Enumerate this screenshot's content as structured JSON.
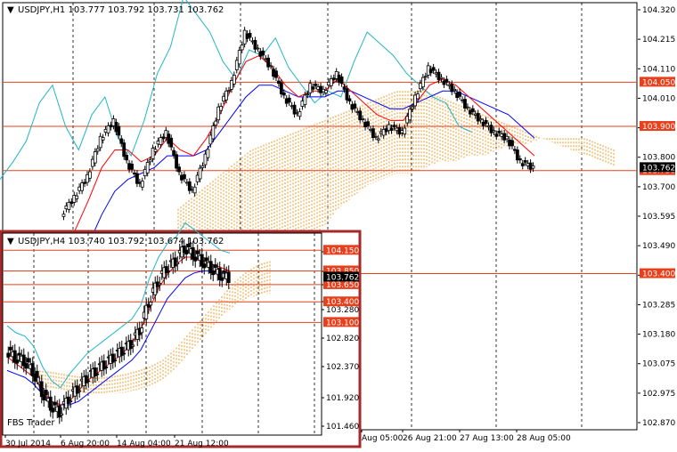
{
  "main_chart": {
    "title": "USDJPY,H1  103.777 103.792 103.731 103.762",
    "y_ticks": [
      "104.320",
      "104.215",
      "104.110",
      "104.010",
      "103.905",
      "103.800",
      "103.700",
      "103.595",
      "103.490",
      "103.385",
      "103.285",
      "103.180",
      "103.075",
      "102.975",
      "102.870"
    ],
    "x_ticks": [
      "Aug 05:00",
      "26 Aug 21:00",
      "27 Aug 13:00",
      "28 Aug 05:00"
    ],
    "levels": [
      {
        "label": "104.050",
        "value": 104.05
      },
      {
        "label": "103.900",
        "value": 103.9
      },
      {
        "label": "103.750",
        "value": 103.75
      },
      {
        "label": "103.400",
        "value": 103.4
      }
    ],
    "current_price_label": "103.762"
  },
  "inset_chart": {
    "title": "USDJPY,H4  103.740 103.792 103.674 103.762",
    "y_ticks": [
      "104.150",
      "103.850",
      "103.650",
      "103.400",
      "103.280",
      "102.820",
      "102.370",
      "101.920",
      "101.460"
    ],
    "x_ticks": [
      "30 Jul 2014",
      "6 Aug 20:00",
      "14 Aug 04:00",
      "21 Aug 12:00"
    ],
    "levels": [
      {
        "label": "104.150",
        "value": 104.15
      },
      {
        "label": "103.850",
        "value": 103.85
      },
      {
        "label": "103.650",
        "value": 103.65
      },
      {
        "label": "103.400",
        "value": 103.4
      },
      {
        "label": "103.100",
        "value": 103.1
      }
    ],
    "current_price_label": "103.762",
    "watermark": "FBS Trader"
  },
  "colors": {
    "level_line": "#e8401c",
    "level_tag": "#e8401c",
    "tenkan": "#ff0000",
    "kijun": "#0000ff",
    "chikou": "#21b5c6",
    "cloud": "#e89b28",
    "candle": "#000000",
    "inset_border": "#a52a2a"
  },
  "chart_data": [
    {
      "type": "candlestick",
      "title": "USDJPY,H1  103.777 103.792 103.731 103.762",
      "ylim": [
        102.87,
        104.32
      ],
      "indicator": "Ichimoku",
      "close_series": [
        103.6,
        103.66,
        103.73,
        103.86,
        103.92,
        103.78,
        103.7,
        103.82,
        103.88,
        103.74,
        103.68,
        103.8,
        103.96,
        104.05,
        104.22,
        104.16,
        104.1,
        104.0,
        103.94,
        104.04,
        104.02,
        104.08,
        103.98,
        103.92,
        103.86,
        103.9,
        103.88,
        104.0,
        104.1,
        104.06,
        104.02,
        103.96,
        103.92,
        103.88,
        103.86,
        103.78,
        103.76
      ],
      "tenkan_series": [
        103.45,
        103.55,
        103.65,
        103.76,
        103.82,
        103.82,
        103.78,
        103.8,
        103.86,
        103.82,
        103.8,
        103.86,
        103.94,
        104.04,
        104.12,
        104.14,
        104.1,
        104.04,
        104.0,
        104.02,
        104.02,
        104.06,
        104.02,
        103.98,
        103.94,
        103.92,
        103.92,
        103.98,
        104.04,
        104.06,
        104.04,
        104.0,
        103.96,
        103.92,
        103.88,
        103.84,
        103.8
      ],
      "kijun_series": [
        103.32,
        103.4,
        103.5,
        103.6,
        103.68,
        103.72,
        103.74,
        103.76,
        103.8,
        103.8,
        103.8,
        103.82,
        103.88,
        103.94,
        104.0,
        104.04,
        104.04,
        104.02,
        104.0,
        104.0,
        104.0,
        104.02,
        104.02,
        104.0,
        103.98,
        103.96,
        103.96,
        103.98,
        104.0,
        104.02,
        104.02,
        104.0,
        103.98,
        103.96,
        103.94,
        103.9,
        103.86
      ],
      "cloud_top": [
        103.62,
        103.66,
        103.7,
        103.74,
        103.78,
        103.82,
        103.84,
        103.86,
        103.88,
        103.9,
        103.92,
        103.94,
        103.96,
        103.98,
        104.0,
        104.02,
        104.02,
        104.02,
        104.0,
        103.98,
        103.96,
        103.94,
        103.92,
        103.9,
        103.88,
        103.86,
        103.84,
        103.82,
        103.8,
        103.78,
        103.76
      ],
      "cloud_bottom": [
        103.48,
        103.44,
        103.4,
        103.36,
        103.34,
        103.34,
        103.36,
        103.4,
        103.44,
        103.5,
        103.56,
        103.62,
        103.66,
        103.7,
        103.72,
        103.74,
        103.74,
        103.76,
        103.78,
        103.78,
        103.8,
        103.8,
        103.82,
        103.84,
        103.84,
        103.86,
        103.86,
        103.86,
        103.86,
        103.84,
        103.82
      ]
    },
    {
      "type": "candlestick",
      "title": "USDJPY,H4  103.740 103.792 103.674 103.762",
      "ylim": [
        101.46,
        104.4
      ],
      "indicator": "Ichimoku",
      "close_series": [
        102.7,
        102.6,
        102.55,
        102.4,
        102.1,
        101.9,
        101.8,
        102.0,
        102.15,
        102.3,
        102.4,
        102.5,
        102.6,
        102.7,
        102.8,
        103.0,
        103.4,
        103.7,
        103.9,
        104.0,
        104.2,
        104.1,
        104.0,
        103.9,
        103.8,
        103.76
      ],
      "tenkan_series": [
        102.6,
        102.5,
        102.4,
        102.3,
        102.1,
        101.95,
        101.9,
        101.95,
        102.1,
        102.25,
        102.35,
        102.45,
        102.55,
        102.65,
        102.8,
        103.0,
        103.3,
        103.6,
        103.8,
        103.95,
        104.05,
        104.05,
        104.0,
        103.95,
        103.9,
        103.85
      ],
      "kijun_series": [
        102.4,
        102.35,
        102.3,
        102.2,
        102.05,
        101.95,
        101.9,
        101.9,
        101.95,
        102.05,
        102.15,
        102.25,
        102.35,
        102.45,
        102.55,
        102.7,
        102.95,
        103.2,
        103.45,
        103.6,
        103.75,
        103.82,
        103.85,
        103.85,
        103.82,
        103.8
      ],
      "cloud_top": [
        102.4,
        102.38,
        102.35,
        102.32,
        102.3,
        102.3,
        102.32,
        102.35,
        102.4,
        102.46,
        102.55,
        102.7,
        102.9,
        103.1,
        103.3,
        103.5,
        103.7,
        103.85,
        103.95,
        104.0
      ],
      "cloud_bottom": [
        102.15,
        102.12,
        102.1,
        102.08,
        102.05,
        102.05,
        102.06,
        102.08,
        102.12,
        102.18,
        102.25,
        102.4,
        102.6,
        102.8,
        103.0,
        103.2,
        103.35,
        103.45,
        103.5,
        103.52
      ]
    }
  ]
}
